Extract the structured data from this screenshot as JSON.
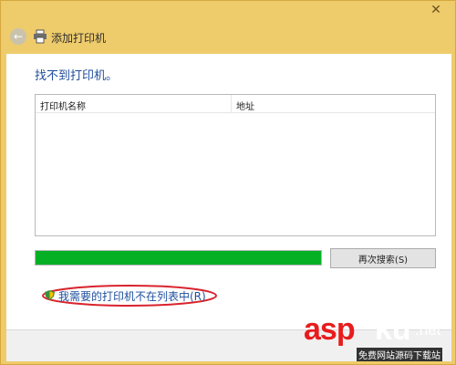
{
  "window": {
    "title": "添加打印机",
    "close_label": "✕",
    "back_label": "←"
  },
  "main": {
    "message": "找不到打印机。",
    "list": {
      "columns": [
        "打印机名称",
        "地址"
      ],
      "rows": []
    },
    "progress_percent": 100,
    "search_again_label": "再次搜索(S)",
    "not_listed_label": "我需要的打印机不在列表中(R)"
  },
  "colors": {
    "frame": "#eecb6b",
    "progress": "#06b025",
    "link": "#1e4f9e",
    "highlight": "#d9232d"
  },
  "watermark": {
    "asp": "asp",
    "ku": "ku",
    "net": ".net",
    "sub": "免费网站源码下载站"
  }
}
